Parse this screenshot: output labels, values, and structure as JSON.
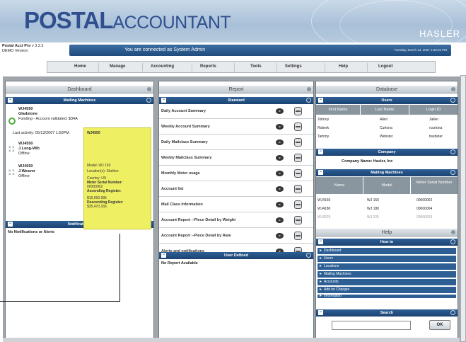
{
  "app": {
    "logo_bold": "POSTAL",
    "logo_thin": "ACCOUNTANT",
    "vendor": "HASLER"
  },
  "version": {
    "name": "Postal Acct Pro",
    "version": "v 3.2.3",
    "mode": "DEMO Version"
  },
  "connection": {
    "message": "You are connected as System Admin",
    "datetime": "Tuesday, March 13, 2007 1:50:40 PM"
  },
  "menu": [
    "Home",
    "Manage",
    "Accounting",
    "Reports",
    "Tools",
    "Settings",
    "Help",
    "Logout"
  ],
  "dashboard": {
    "title": "Dashboard",
    "mailing_machines": "Mailing Machines",
    "m1": {
      "code": "WJ4550",
      "owner": "Gladstone",
      "status": "Funding - Account validated: $34A"
    },
    "last_activity": "Last activity: 05/13/2007 1:50PM",
    "m2": {
      "code": "WJ4550",
      "owner": "J.Long-Wih",
      "status": "Offline"
    },
    "m3": {
      "code": "WJ4550",
      "owner": "J.Weaver",
      "status": "Offline"
    },
    "notifications_title": "Notifications",
    "notifications_body": "No Notifications or Alerts"
  },
  "popup": {
    "header": "WJ4550",
    "lines": [
      "Model: WJ 150",
      "Location(s): Shelton",
      "Country: US",
      "Meter Serial Number:",
      "00000002",
      "Ascending Register:",
      "$19,993.995",
      "Descending Register:",
      "$35,470.166"
    ]
  },
  "report": {
    "title": "Report",
    "standard": "Standard",
    "items": [
      "Daily Account Summary",
      "Weekly Account Summary",
      "Daily Mailclass Summary",
      "Weekly Mailclass Summary",
      "Monthly Meter usage",
      "Account list",
      "Mail Class Information",
      "Account Report --Piece Detail by Weight",
      "Account Report --Piece Detail by Rate",
      "Alerts and notifications"
    ],
    "user_defined": "User Defined",
    "no_report": "No Report Available"
  },
  "database": {
    "title": "Database",
    "users": "Users",
    "user_headers": [
      "First Name",
      "Last Name",
      "Login ID"
    ],
    "user_rows": [
      [
        "Johnny",
        "Allen",
        "Jallen"
      ],
      [
        "Roberk",
        "Curtona",
        "rcurtona"
      ],
      [
        "Tammy",
        "Webster",
        "twebster"
      ]
    ],
    "company": "Company",
    "company_name": "Company Name: Hasler, Inc",
    "mailing_machines": "Mailing Machines",
    "mm_headers": [
      "Name",
      "Model",
      "Meter Serial Number"
    ],
    "mm_rows": [
      [
        "WJ4150",
        "WJ 150",
        "00000002"
      ],
      [
        "WJ4180",
        "WJ 180",
        "00000004"
      ],
      [
        "WJ4225",
        "WJ 225",
        "00000003"
      ]
    ]
  },
  "help": {
    "title": "Help",
    "howto": "How to",
    "items": [
      "Dashboard",
      "Users",
      "Locations",
      "Mailing Machines",
      "Accounts",
      "Add on Charges",
      "Information"
    ],
    "search": "Search",
    "ok": "OK"
  }
}
